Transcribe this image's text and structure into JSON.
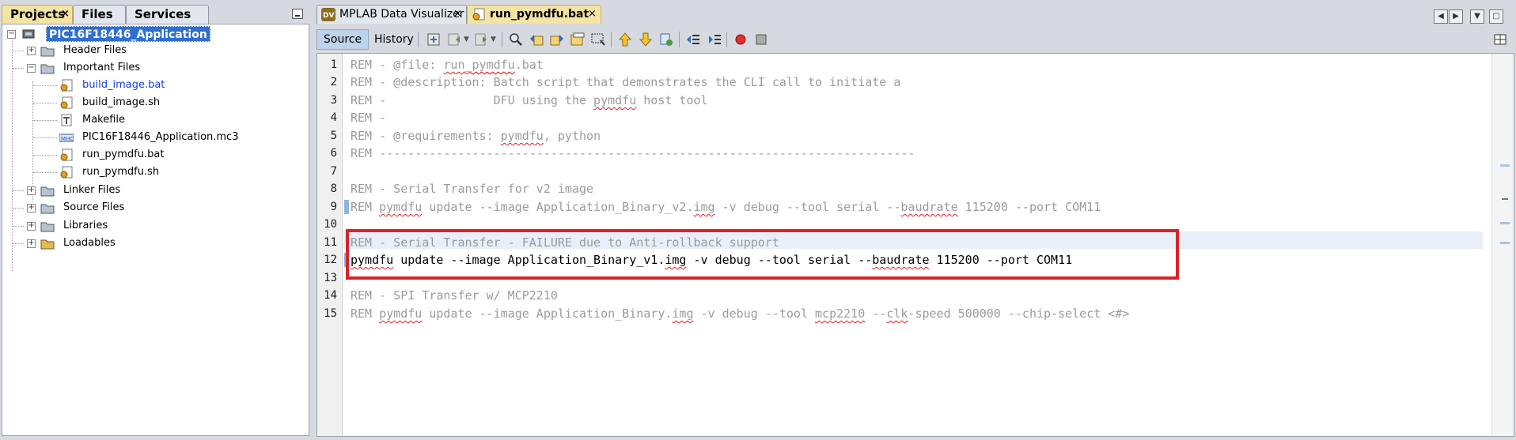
{
  "project_panel": {
    "tabs": [
      "Projects",
      "Files",
      "Services"
    ],
    "tree": {
      "root": "PIC16F18446_Application",
      "header_files": "Header Files",
      "important_files": "Important Files",
      "files": [
        "build_image.bat",
        "build_image.sh",
        "Makefile",
        "PIC16F18446_Application.mc3",
        "run_pymdfu.bat",
        "run_pymdfu.sh"
      ],
      "linker_files": "Linker Files",
      "source_files": "Source Files",
      "libraries": "Libraries",
      "loadables": "Loadables"
    },
    "tree_icons": {
      "project": "chip-project-icon",
      "folder": "folder-icon",
      "script": "gear-script-icon",
      "makefile": "makefile-icon",
      "mc3": "mhc-file-icon"
    }
  },
  "editor": {
    "tabs": [
      {
        "label": "MPLAB Data Visualizer",
        "icon": "data-visualizer-icon"
      },
      {
        "label": "run_pymdfu.bat",
        "icon": "gear-script-icon"
      }
    ],
    "mode_tabs": {
      "source": "Source",
      "history": "History"
    },
    "lines": [
      {
        "n": "1",
        "text": "REM - @file: run_pymdfu.bat"
      },
      {
        "n": "2",
        "text": "REM - @description: Batch script that demonstrates the CLI call to initiate a"
      },
      {
        "n": "3",
        "text": "REM -               DFU using the pymdfu host tool"
      },
      {
        "n": "4",
        "text": "REM -"
      },
      {
        "n": "5",
        "text": "REM - @requirements: pymdfu, python"
      },
      {
        "n": "6",
        "text": "REM ---------------------------------------------------------------------------"
      },
      {
        "n": "7",
        "text": ""
      },
      {
        "n": "8",
        "text": "REM - Serial Transfer for v2 image"
      },
      {
        "n": "9",
        "text": "REM pymdfu update --image Application_Binary_v2.img -v debug --tool serial --baudrate 115200 --port COM11"
      },
      {
        "n": "10",
        "text": ""
      },
      {
        "n": "11",
        "text": "REM - Serial Transfer - FAILURE due to Anti-rollback support"
      },
      {
        "n": "12",
        "text": "pymdfu update --image Application_Binary_v1.img -v debug --tool serial --baudrate 115200 --port COM11"
      },
      {
        "n": "13",
        "text": ""
      },
      {
        "n": "14",
        "text": "REM - SPI Transfer w/ MCP2210"
      },
      {
        "n": "15",
        "text": "REM pymdfu update --image Application_Binary.img -v debug --tool mcp2210 --clk-speed 500000 --chip-select <#>"
      }
    ]
  },
  "colors": {
    "highlight_box": "#d9232a",
    "active_tab": "#f4e3a3",
    "selected_node": "#2f6fd0"
  }
}
